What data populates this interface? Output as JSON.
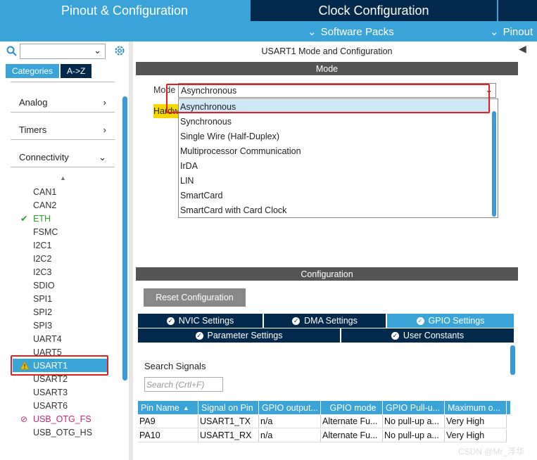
{
  "tabs": {
    "pinout": "Pinout & Configuration",
    "clock": "Clock Configuration",
    "software_packs": "Software Packs",
    "pinout_sub": "Pinout"
  },
  "left": {
    "category_tab": "Categories",
    "az_tab": "A->Z",
    "categories": [
      {
        "label": "Analog"
      },
      {
        "label": "Timers"
      },
      {
        "label": "Connectivity"
      }
    ],
    "peripherals": [
      "CAN1",
      "CAN2",
      "ETH",
      "FSMC",
      "I2C1",
      "I2C2",
      "I2C3",
      "SDIO",
      "SPI1",
      "SPI2",
      "SPI3",
      "UART4",
      "UART5",
      "USART1",
      "USART2",
      "USART3",
      "USART6",
      "USB_OTG_FS",
      "USB_OTG_HS"
    ]
  },
  "mode_panel": {
    "title": "USART1 Mode and Configuration",
    "header": "Mode",
    "mode_label": "Mode",
    "mode_value": "Asynchronous",
    "hw_label": "Hardw",
    "options": [
      "Asynchronous",
      "Synchronous",
      "Single Wire (Half-Duplex)",
      "Multiprocessor Communication",
      "IrDA",
      "LIN",
      "SmartCard",
      "SmartCard with Card Clock"
    ]
  },
  "config": {
    "header": "Configuration",
    "reset_button": "Reset Configuration",
    "tabs": [
      "NVIC Settings",
      "DMA Settings",
      "GPIO Settings",
      "Parameter Settings",
      "User Constants"
    ],
    "search_label": "Search Signals",
    "search_placeholder": "Search (Crtl+F)",
    "columns": [
      "Pin Name",
      "Signal on Pin",
      "GPIO output...",
      "GPIO mode",
      "GPIO Pull-u...",
      "Maximum o..."
    ],
    "rows": [
      [
        "PA9",
        "USART1_TX",
        "n/a",
        "Alternate Fu...",
        "No pull-up a...",
        "Very High"
      ],
      [
        "PA10",
        "USART1_RX",
        "n/a",
        "Alternate Fu...",
        "No pull-up a...",
        "Very High"
      ]
    ]
  },
  "watermark": "CSDN @Mr_浮华"
}
